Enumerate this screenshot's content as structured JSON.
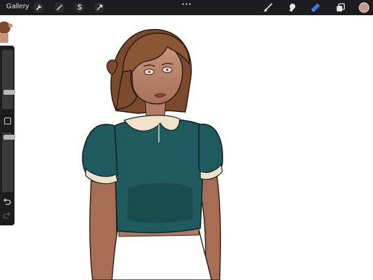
{
  "toolbar": {
    "gallery_label": "Gallery",
    "tools": [
      "wrench-icon",
      "magic-wand-icon",
      "selection-icon",
      "transform-icon"
    ],
    "brush_tools": [
      "brush-icon",
      "smudge-icon",
      "eraser-icon",
      "layers-icon",
      "color-swatch"
    ],
    "active_tool": "eraser-icon",
    "accent_color": "#2f7cf6",
    "current_color": "#c49c82"
  },
  "sidebar": {
    "size_slider_level": 0.74,
    "opacity_slider_level": 0.04,
    "buttons": [
      "modify-button",
      "undo-button",
      "redo-button"
    ]
  },
  "canvas": {
    "subject": "illustration-of-girl-in-teal-shirt"
  }
}
